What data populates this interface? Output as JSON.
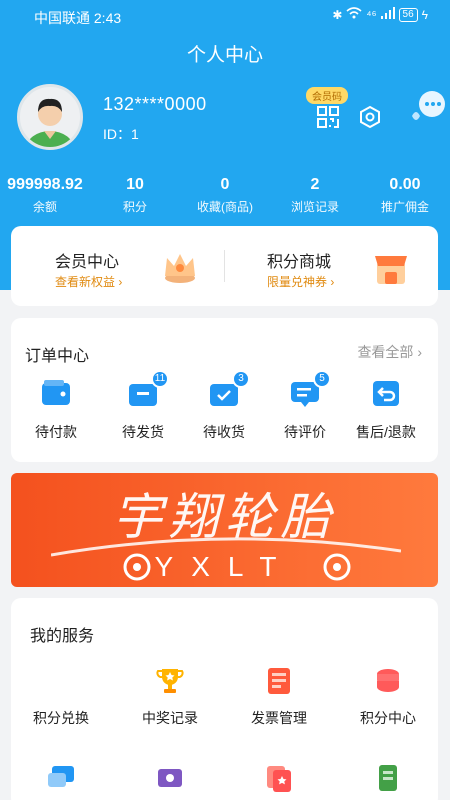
{
  "status_bar": {
    "carrier_time": "中国联通 2:43",
    "network": "⁴⁶",
    "battery": "56"
  },
  "page_title": "个人中心",
  "profile": {
    "phone": "132****0000",
    "id_label": "ID：1",
    "vip_code_label": "会员码"
  },
  "stats": [
    {
      "value": "999998.92",
      "label": "余额"
    },
    {
      "value": "10",
      "label": "积分"
    },
    {
      "value": "0",
      "label": "收藏(商品)"
    },
    {
      "value": "2",
      "label": "浏览记录"
    },
    {
      "value": "0.00",
      "label": "推广佣金"
    }
  ],
  "vip_center": {
    "title": "会员中心",
    "subtitle": "查看新权益 ›"
  },
  "points_mall": {
    "title": "积分商城",
    "subtitle": "限量兑神券 ›"
  },
  "orders": {
    "heading": "订单中心",
    "view_all": "查看全部 ›",
    "items": [
      {
        "label": "待付款",
        "badge": ""
      },
      {
        "label": "待发货",
        "badge": "11"
      },
      {
        "label": "待收货",
        "badge": "3"
      },
      {
        "label": "待评价",
        "badge": "5"
      },
      {
        "label": "售后/退款",
        "badge": ""
      }
    ]
  },
  "banner": {
    "title": "宇翔轮胎",
    "subtitle": "YXLT"
  },
  "services": {
    "heading": "我的服务",
    "items": [
      {
        "label": "积分兑换"
      },
      {
        "label": "中奖记录"
      },
      {
        "label": "发票管理"
      },
      {
        "label": "积分中心"
      }
    ]
  },
  "colors": {
    "primary": "#22a7f0",
    "accent": "#e08a10",
    "banner": "#f4511e"
  }
}
